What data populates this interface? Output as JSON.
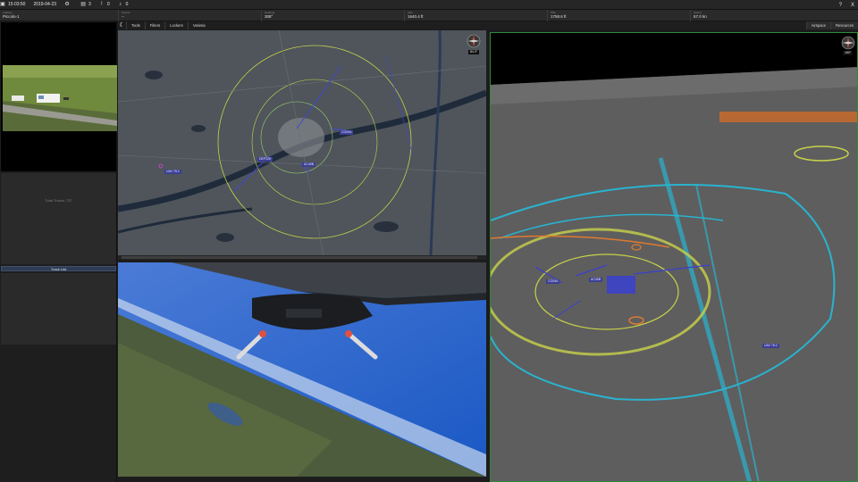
{
  "status_bar": {
    "time": "15:03:50",
    "date": "2019-04-23",
    "count_a": "3",
    "count_b": "0",
    "count_c": "0",
    "help": "?",
    "close": "X"
  },
  "telemetry": [
    {
      "label": "Callsign",
      "value": "Piccolo-1"
    },
    {
      "label": "Source",
      "value": "--"
    },
    {
      "label": "Heading",
      "value": "308°"
    },
    {
      "label": "AGL",
      "value": "1640.4 ft"
    },
    {
      "label": "MSL",
      "value": "1758.6 ft"
    },
    {
      "label": "Speed",
      "value": "57.0 kn"
    }
  ],
  "left_panel": {
    "total_tracks": "Total Tracks: 737",
    "track_list_button": "Track List"
  },
  "map_toolbar": {
    "tabs": [
      "Tools",
      "Filters",
      "Lockers",
      "Varietia"
    ],
    "right_tabs": [
      "Airspace",
      "Resources"
    ]
  },
  "map2d": {
    "labels": [
      "CG09A",
      "DEP22E",
      "AC45B",
      "UAV 78.2"
    ],
    "compass_value": "84.0°"
  },
  "view3d": {
    "labels": [
      "CG09A",
      "AC45B",
      "UAV 78.2"
    ],
    "compass_value": "180°"
  },
  "colors": {
    "accent_green": "#2f8a3a",
    "track_blue": "#3c3f96",
    "zone_yellow": "#c8d24a",
    "zone_cyan": "#2ab3cf"
  }
}
